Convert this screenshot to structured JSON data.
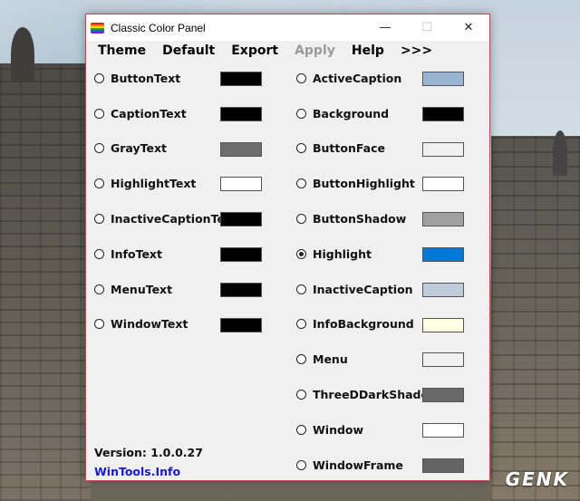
{
  "window": {
    "title": "Classic Color Panel",
    "controls": {
      "minimize": "—",
      "maximize": "☐",
      "close": "✕"
    }
  },
  "menu": [
    {
      "label": "Theme",
      "enabled": true
    },
    {
      "label": "Default",
      "enabled": true
    },
    {
      "label": "Export",
      "enabled": true
    },
    {
      "label": "Apply",
      "enabled": false
    },
    {
      "label": "Help",
      "enabled": true
    },
    {
      "label": ">>>",
      "enabled": true
    }
  ],
  "left_items": [
    {
      "label": "ButtonText",
      "color": "#000000",
      "checked": false
    },
    {
      "label": "CaptionText",
      "color": "#000000",
      "checked": false
    },
    {
      "label": "GrayText",
      "color": "#6d6d6d",
      "checked": false
    },
    {
      "label": "HighlightText",
      "color": "#ffffff",
      "checked": false
    },
    {
      "label": "InactiveCaptionText",
      "color": "#000000",
      "checked": false
    },
    {
      "label": "InfoText",
      "color": "#000000",
      "checked": false
    },
    {
      "label": "MenuText",
      "color": "#000000",
      "checked": false
    },
    {
      "label": "WindowText",
      "color": "#000000",
      "checked": false
    }
  ],
  "right_items": [
    {
      "label": "ActiveCaption",
      "color": "#99b4d1",
      "checked": false
    },
    {
      "label": "Background",
      "color": "#000000",
      "checked": false
    },
    {
      "label": "ButtonFace",
      "color": "#f0f0f0",
      "checked": false
    },
    {
      "label": "ButtonHighlight",
      "color": "#ffffff",
      "checked": false
    },
    {
      "label": "ButtonShadow",
      "color": "#a0a0a0",
      "checked": false
    },
    {
      "label": "Highlight",
      "color": "#0078d7",
      "checked": true
    },
    {
      "label": "InactiveCaption",
      "color": "#bfcddb",
      "checked": false
    },
    {
      "label": "InfoBackground",
      "color": "#ffffe1",
      "checked": false
    },
    {
      "label": "Menu",
      "color": "#f0f0f0",
      "checked": false
    },
    {
      "label": "ThreeDDarkShadow",
      "color": "#696969",
      "checked": false
    },
    {
      "label": "Window",
      "color": "#ffffff",
      "checked": false
    },
    {
      "label": "WindowFrame",
      "color": "#646464",
      "checked": false
    }
  ],
  "footer": {
    "version": "Version: 1.0.0.27",
    "link": "WinTools.Info"
  },
  "watermark": "GENK"
}
